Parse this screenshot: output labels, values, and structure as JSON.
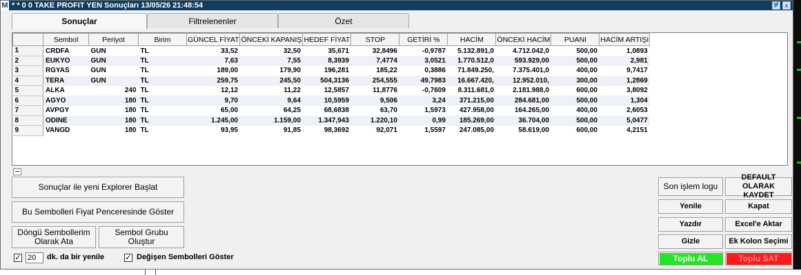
{
  "window": {
    "app_letter": "M",
    "title": "* * 0  0 TAKE PROFIT YEN Sonuçları  13/05/26 21:48:54",
    "twitter_icon": "twitter-icon",
    "close_glyph": "x"
  },
  "tabs": [
    {
      "label": "Sonuçlar",
      "active": true
    },
    {
      "label": "Filtrelenenler",
      "active": false
    },
    {
      "label": "Özet",
      "active": false
    }
  ],
  "table": {
    "columns": [
      "",
      "Sembol",
      "Periyot",
      "Birim",
      "GÜNCEL FİYAT",
      "ÖNCEKİ KAPANIŞ",
      "HEDEF FİYAT",
      "STOP",
      "GETİRİ %",
      "HACİM",
      "ÖNCEKİ HACİM",
      "PUANI",
      "HACİM ARTIŞI"
    ],
    "rows": [
      [
        "1",
        "CRDFA",
        "GUN",
        "TL",
        "33,52",
        "32,50",
        "35,671",
        "32,8496",
        "-0,9787",
        "5.132.891,0",
        "4.712.042,0",
        "500,00",
        "1,0893"
      ],
      [
        "2",
        "EUKYO",
        "GUN",
        "TL",
        "7,63",
        "7,55",
        "8,3939",
        "7,4774",
        "3,0521",
        "1.770.512,0",
        "593.929,00",
        "500,00",
        "2,981"
      ],
      [
        "3",
        "RGYAS",
        "GUN",
        "TL",
        "189,00",
        "179,90",
        "196,281",
        "185,22",
        "0,3886",
        "71.849.250,",
        "7.375.401,0",
        "400,00",
        "9,7417"
      ],
      [
        "4",
        "TERA",
        "GUN",
        "TL",
        "259,75",
        "245,50",
        "504,3136",
        "254,555",
        "49,7983",
        "16.667.420,",
        "12.952.010,",
        "300,00",
        "1,2869"
      ],
      [
        "5",
        "ALKA",
        "240",
        "TL",
        "12,12",
        "11,22",
        "12,5857",
        "11,8776",
        "-0,7609",
        "8.311.681,0",
        "2.181.988,0",
        "600,00",
        "3,8092"
      ],
      [
        "6",
        "AGYO",
        "180",
        "TL",
        "9,70",
        "9,64",
        "10,5959",
        "9,506",
        "3,24",
        "371.215,00",
        "284.681,00",
        "500,00",
        "1,304"
      ],
      [
        "7",
        "AVPGY",
        "180",
        "TL",
        "65,00",
        "64,25",
        "68,6838",
        "63,70",
        "1,5973",
        "427.958,00",
        "164.265,00",
        "400,00",
        "2,6053"
      ],
      [
        "8",
        "ODINE",
        "180",
        "TL",
        "1.245,00",
        "1.159,00",
        "1.347,943",
        "1.220,10",
        "0,99",
        "185.269,00",
        "36.704,00",
        "500,00",
        "5,0477"
      ],
      [
        "9",
        "VANGD",
        "180",
        "TL",
        "93,95",
        "91,85",
        "98,3692",
        "92,071",
        "1,5597",
        "247.085,00",
        "58.619,00",
        "600,00",
        "4,2151"
      ]
    ]
  },
  "left_buttons": {
    "new_explorer": "Sonuçlar ile yeni Explorer Başlat",
    "show_in_price_window": "Bu Sembolleri Fiyat Penceresinde Göster",
    "assign_loop_symbols": "Döngü Sembollerim Olarak Ata",
    "create_symbol_group": "Sembol Grubu Oluştur"
  },
  "refresh": {
    "checked": true,
    "minutes": "20",
    "label": "dk. da bir yenile",
    "check_glyph": "✓"
  },
  "changed_symbols": {
    "checked": true,
    "label": "Değişen Sembolleri Göster"
  },
  "right_buttons": {
    "last_log": "Son işlem logu",
    "save_default": "DEFAULT OLARAK KAYDET",
    "refresh": "Yenile",
    "close": "Kapat",
    "print": "Yazdır",
    "to_excel": "Excel'e Aktar",
    "hide": "Gizle",
    "extra_column": "Ek Kolon Seçimi",
    "bulk_buy": "Toplu AL",
    "bulk_sell": "Toplu SAT"
  },
  "colors": {
    "titlebar": "#0f3d63",
    "buy": "#22e622",
    "sell": "#ff1a1a"
  }
}
